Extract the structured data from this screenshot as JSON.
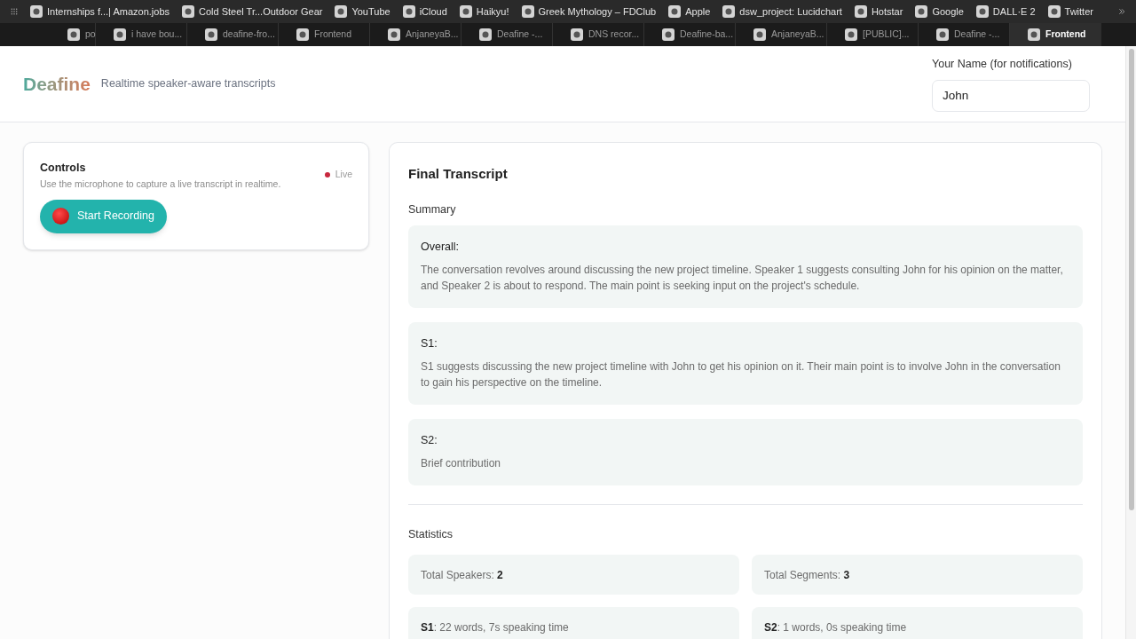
{
  "bookmarks": [
    "Internships f...| Amazon.jobs",
    "Cold Steel Tr...Outdoor Gear",
    "YouTube",
    "iCloud",
    "Haikyu!",
    "Greek Mythology – FDClub",
    "Apple",
    "dsw_project: Lucidchart",
    "Hotstar",
    "Google",
    "DALL·E 2",
    "Twitter"
  ],
  "tabs": [
    {
      "title": "po",
      "selected": false
    },
    {
      "title": "i have bou...",
      "selected": false
    },
    {
      "title": "deafine-fro...",
      "selected": false
    },
    {
      "title": "Frontend",
      "selected": false
    },
    {
      "title": "AnjaneyaB...",
      "selected": false
    },
    {
      "title": "Deafine -...",
      "selected": false
    },
    {
      "title": "DNS recor...",
      "selected": false
    },
    {
      "title": "Deafine-ba...",
      "selected": false
    },
    {
      "title": "AnjaneyaB...",
      "selected": false
    },
    {
      "title": "[PUBLIC]...",
      "selected": false
    },
    {
      "title": "Deafine -...",
      "selected": false
    },
    {
      "title": "Frontend",
      "selected": true
    }
  ],
  "header": {
    "logo": "Deafine",
    "tagline": "Realtime speaker-aware transcripts",
    "name_label": "Your Name (for notifications)",
    "name_value": "John"
  },
  "controls": {
    "title": "Controls",
    "description": "Use the microphone to capture a live transcript in realtime.",
    "status": "Live",
    "button": "Start Recording"
  },
  "transcript": {
    "title": "Final Transcript",
    "summary_heading": "Summary",
    "summaries": [
      {
        "label": "Overall:",
        "text": "The conversation revolves around discussing the new project timeline. Speaker 1 suggests consulting John for his opinion on the matter, and Speaker 2 is about to respond. The main point is seeking input on the project's schedule."
      },
      {
        "label": "S1:",
        "text": "S1 suggests discussing the new project timeline with John to get his opinion on it. Their main point is to involve John in the conversation to gain his perspective on the timeline."
      },
      {
        "label": "S2:",
        "text": "Brief contribution"
      }
    ],
    "statistics_heading": "Statistics",
    "stats": [
      "Total Speakers: **2**",
      "Total Segments: **3**",
      "**S1**: 22 words, 7s speaking time",
      "**S2**: 1 words, 0s speaking time"
    ]
  }
}
